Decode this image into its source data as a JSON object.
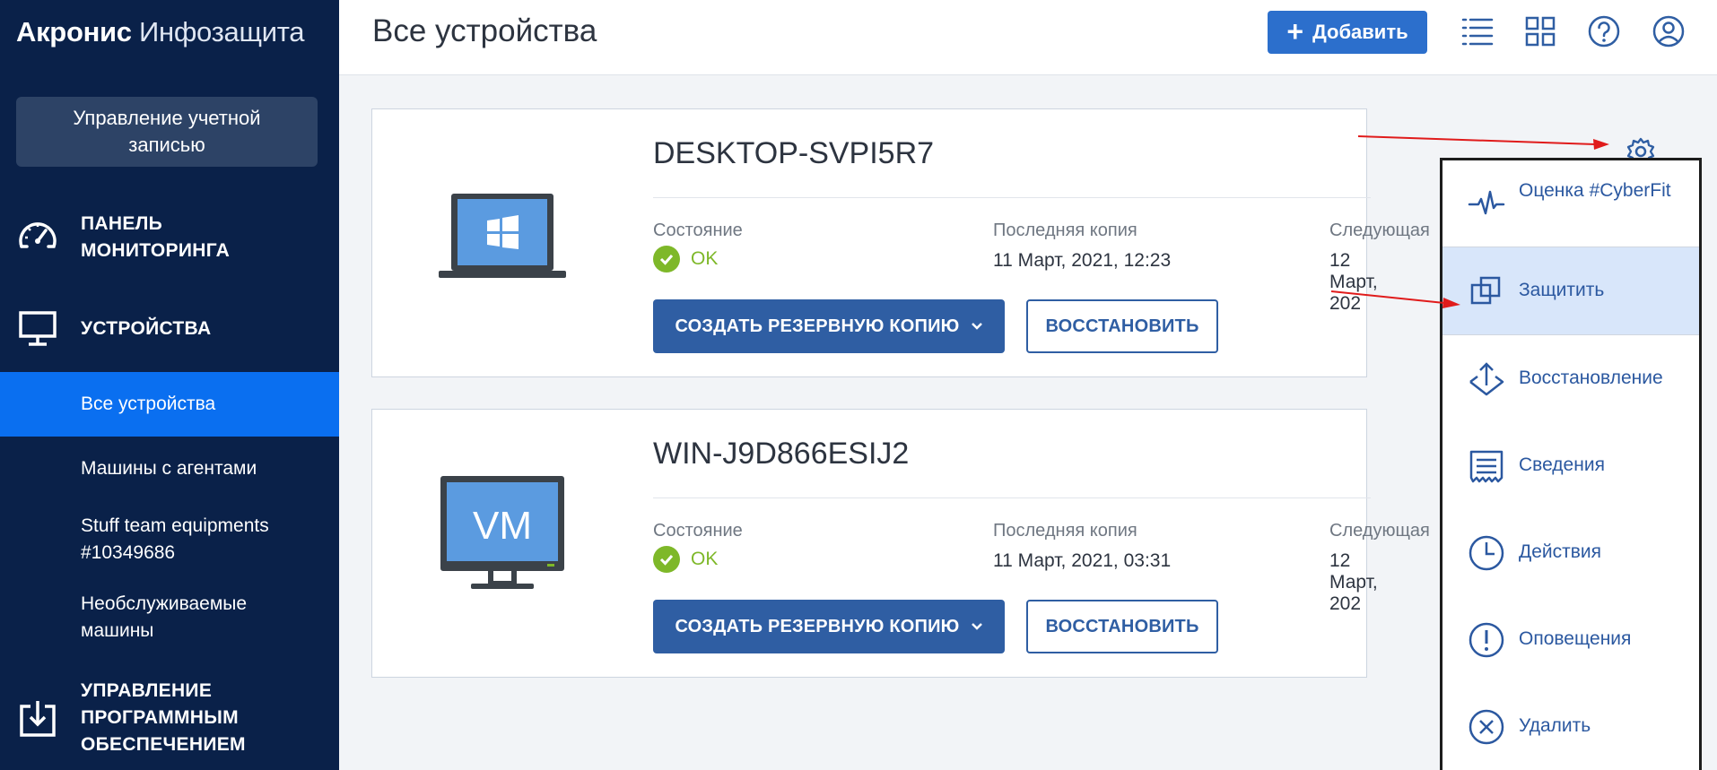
{
  "brand": {
    "bold": "Акронис",
    "light": "Инфозащита"
  },
  "sidebar": {
    "account_button": "Управление учетной записью",
    "dashboard": "ПАНЕЛЬ МОНИТОРИНГА",
    "devices": "УСТРОЙСТВА",
    "sub_items": [
      "Все устройства",
      "Машины с агентами",
      "Stuff team equipments #10349686",
      "Необслуживаемые машины"
    ],
    "software": "УПРАВЛЕНИЕ ПРОГРАММНЫМ ОБЕСПЕЧЕНИЕМ"
  },
  "header": {
    "title": "Все устройства",
    "add_label": "Добавить",
    "icons": [
      "list-view-icon",
      "grid-view-icon",
      "help-icon",
      "account-icon"
    ]
  },
  "devices": [
    {
      "name": "DESKTOP-SVPI5R7",
      "type": "windows-laptop",
      "status_label": "Состояние",
      "status_value": "OK",
      "last_label": "Последняя копия",
      "last_value": "11 Март, 2021, 12:23",
      "next_label": "Следующая",
      "next_value": "12 Март, 202",
      "backup_label": "СОЗДАТЬ РЕЗЕРВНУЮ КОПИЮ",
      "restore_label": "ВОССТАНОВИТЬ"
    },
    {
      "name": "WIN-J9D866ESIJ2",
      "type": "vm",
      "vm_text": "VM",
      "status_label": "Состояние",
      "status_value": "OK",
      "last_label": "Последняя копия",
      "last_value": "11 Март, 2021, 03:31",
      "next_label": "Следующая",
      "next_value": "12 Март, 202",
      "backup_label": "СОЗДАТЬ РЕЗЕРВНУЮ КОПИЮ",
      "restore_label": "ВОССТАНОВИТЬ"
    }
  ],
  "menu": {
    "items": [
      {
        "label": "Оценка #CyberFit",
        "icon": "pulse-icon"
      },
      {
        "label": "Защитить",
        "icon": "protect-icon",
        "highlighted": true
      },
      {
        "label": "Восстановление",
        "icon": "recovery-icon"
      },
      {
        "label": "Сведения",
        "icon": "details-icon"
      },
      {
        "label": "Действия",
        "icon": "clock-icon"
      },
      {
        "label": "Оповещения",
        "icon": "alert-icon"
      },
      {
        "label": "Удалить",
        "icon": "delete-icon"
      }
    ]
  },
  "colors": {
    "sidebar_bg": "#0a2149",
    "active_nav": "#0a6ff0",
    "primary": "#2f5ea3",
    "ok_green": "#7eb829",
    "menu_highlight": "#d8e6fa",
    "annotation_arrow": "#e01b1b"
  }
}
